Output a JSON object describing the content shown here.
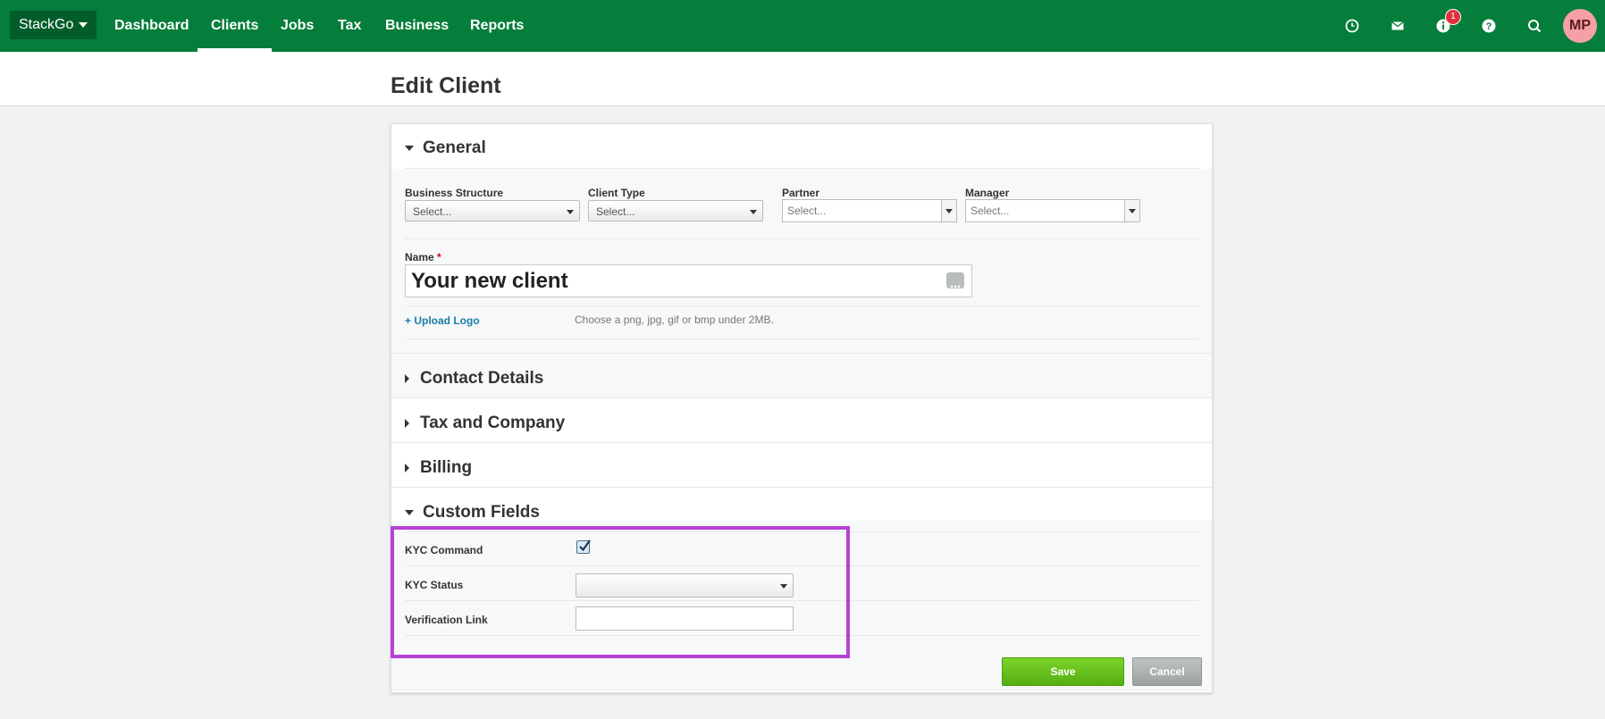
{
  "nav": {
    "brand": "StackGo",
    "links": [
      "Dashboard",
      "Clients",
      "Jobs",
      "Tax",
      "Business",
      "Reports"
    ],
    "active": "Clients",
    "notification_count": "1",
    "avatar_initials": "MP",
    "icons": [
      "clock-icon",
      "mail-icon",
      "info-icon",
      "help-icon",
      "search-icon"
    ]
  },
  "page": {
    "title": "Edit Client"
  },
  "general": {
    "heading": "General",
    "business_structure": {
      "label": "Business Structure",
      "value": "Select..."
    },
    "client_type": {
      "label": "Client Type",
      "value": "Select..."
    },
    "partner": {
      "label": "Partner",
      "placeholder": "Select..."
    },
    "manager": {
      "label": "Manager",
      "placeholder": "Select..."
    },
    "name": {
      "label": "Name",
      "required_marker": "*",
      "value": "Your new client"
    },
    "upload_logo": "+ Upload Logo",
    "upload_hint": "Choose a png, jpg, gif or bmp under 2MB."
  },
  "sections": {
    "contact": "Contact Details",
    "tax": "Tax and Company",
    "billing": "Billing",
    "custom": "Custom Fields"
  },
  "custom_fields": {
    "kyc_command": {
      "label": "KYC Command",
      "checked": true
    },
    "kyc_status": {
      "label": "KYC Status",
      "value": ""
    },
    "verification_link": {
      "label": "Verification Link",
      "value": ""
    }
  },
  "actions": {
    "save": "Save",
    "cancel": "Cancel"
  },
  "colors": {
    "nav": "#047e3a",
    "save": "#5cb518",
    "highlight": "#b642d6",
    "link": "#1a7dab"
  }
}
